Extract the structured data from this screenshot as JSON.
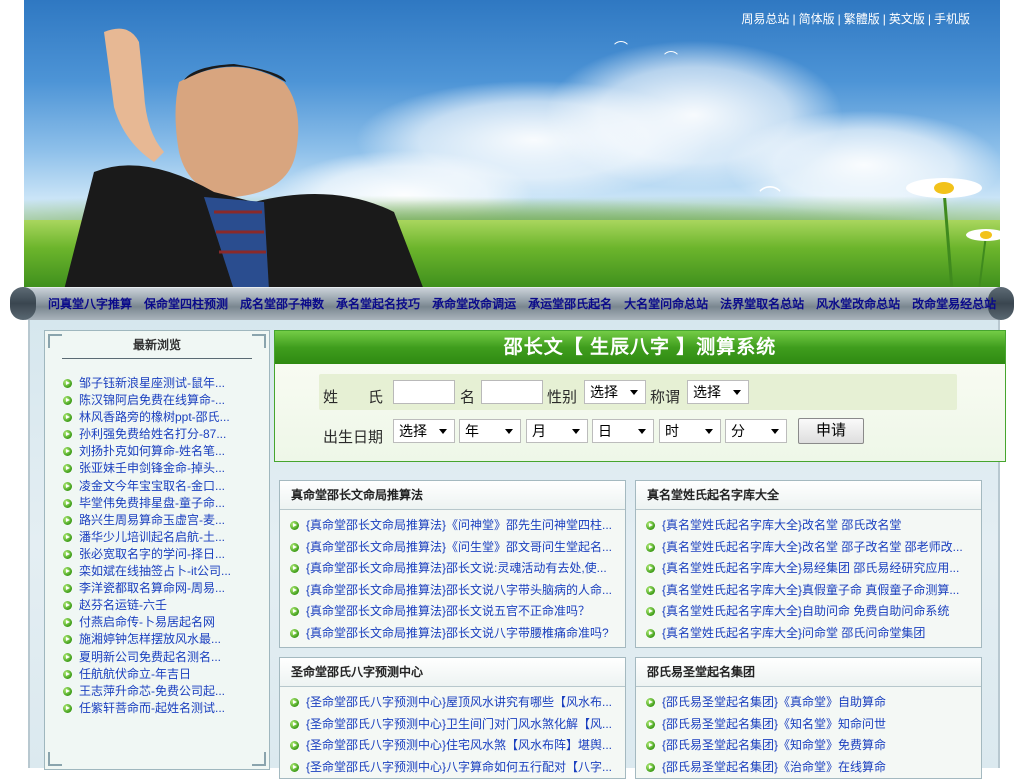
{
  "top_links": [
    "周易总站",
    "简体版",
    "繁體版",
    "英文版",
    "手机版"
  ],
  "banner": {
    "title": ""
  },
  "nav": [
    "问真堂八字推算",
    "保命堂四柱预测",
    "成名堂邵子神数",
    "承名堂起名技巧",
    "承命堂改命调运",
    "承运堂邵氏起名",
    "大名堂问命总站",
    "法界堂取名总站",
    "风水堂改命总站",
    "改命堂易经总站"
  ],
  "sidebar": {
    "title": "最新浏览",
    "items": [
      "邹子钰新浪星座测试-鼠年...",
      "陈汉锦阿启免费在线算命-...",
      "林风香路旁的橡树ppt-邵氏...",
      "孙利强免费给姓名打分-87...",
      "刘扬扑克如何算命-姓名笔...",
      "张亚妹壬申剑锋金命-掉头...",
      "凌金文今年宝宝取名-金口...",
      "毕堂伟免费排星盘-童子命...",
      "路兴生周易算命玉虚宫-麦...",
      "潘华少儿培训起名启航-土...",
      "张必宽取名字的学问-择日...",
      "栾如斌在线抽签占卜-it公司...",
      "李洋瓷都取名算命网-周易...",
      "赵芬名运链-六壬",
      "付燕启命传-卜易居起名网",
      "施湘婷钟怎样摆放风水最...",
      "夏明新公司免费起名测名...",
      "任航航伏命立-年吉日",
      "王志萍升命芯-免费公司起...",
      "任紫轩菩命而-起姓名测试..."
    ]
  },
  "calculator": {
    "title": "邵长文【 生辰八字 】测算系统",
    "labels": {
      "surname": "姓　　氏",
      "name": "名",
      "gender": "性别",
      "title": "称谓",
      "birth": "出生日期"
    },
    "selects": {
      "gender": "选择",
      "title": "选择",
      "calendar": "选择",
      "year": "年",
      "month": "月",
      "day": "日",
      "hour": "时",
      "minute": "分"
    },
    "submit": "申请"
  },
  "boxes": [
    {
      "title": "真命堂邵长文命局推算法",
      "items": [
        "{真命堂邵长文命局推算法}《问神堂》邵先生问神堂四柱...",
        "{真命堂邵长文命局推算法}《问生堂》邵文哥问生堂起名...",
        "{真命堂邵长文命局推算法}邵长文说:灵魂活动有去处,使...",
        "{真命堂邵长文命局推算法}邵长文说八字带头脑病的人命...",
        "{真命堂邵长文命局推算法}邵长文说五官不正命准吗？",
        "{真命堂邵长文命局推算法}邵长文说八字带腰椎痛命准吗?"
      ]
    },
    {
      "title": "真名堂姓氏起名字库大全",
      "items": [
        "{真名堂姓氏起名字库大全}改名堂 邵氏改名堂",
        "{真名堂姓氏起名字库大全}改名堂 邵子改名堂 邵老师改...",
        "{真名堂姓氏起名字库大全}易经集团 邵氏易经研究应用...",
        "{真名堂姓氏起名字库大全}真假童子命 真假童子命测算...",
        "{真名堂姓氏起名字库大全}自助问命 免费自助问命系统",
        "{真名堂姓氏起名字库大全}问命堂 邵氏问命堂集团"
      ]
    },
    {
      "title": "圣命堂邵氏八字预测中心",
      "items": [
        "{圣命堂邵氏八字预测中心}屋顶风水讲究有哪些【风水布...",
        "{圣命堂邵氏八字预测中心}卫生间门对门风水煞化解【风...",
        "{圣命堂邵氏八字预测中心}住宅风水煞【风水布阵】堪舆...",
        "{圣命堂邵氏八字预测中心}八字算命如何五行配对【八字..."
      ]
    },
    {
      "title": "邵氏易圣堂起名集团",
      "items": [
        "{邵氏易圣堂起名集团}《真命堂》自助算命",
        "{邵氏易圣堂起名集团}《知名堂》知命问世",
        "{邵氏易圣堂起名集团}《知命堂》免费算命",
        "{邵氏易圣堂起名集团}《治命堂》在线算命"
      ]
    }
  ],
  "colors": {
    "link": "#1a3fbf",
    "nav_text": "#0a0a8a",
    "calc_green": "#3f9d1d",
    "bullet_green": "#3c9b17"
  }
}
